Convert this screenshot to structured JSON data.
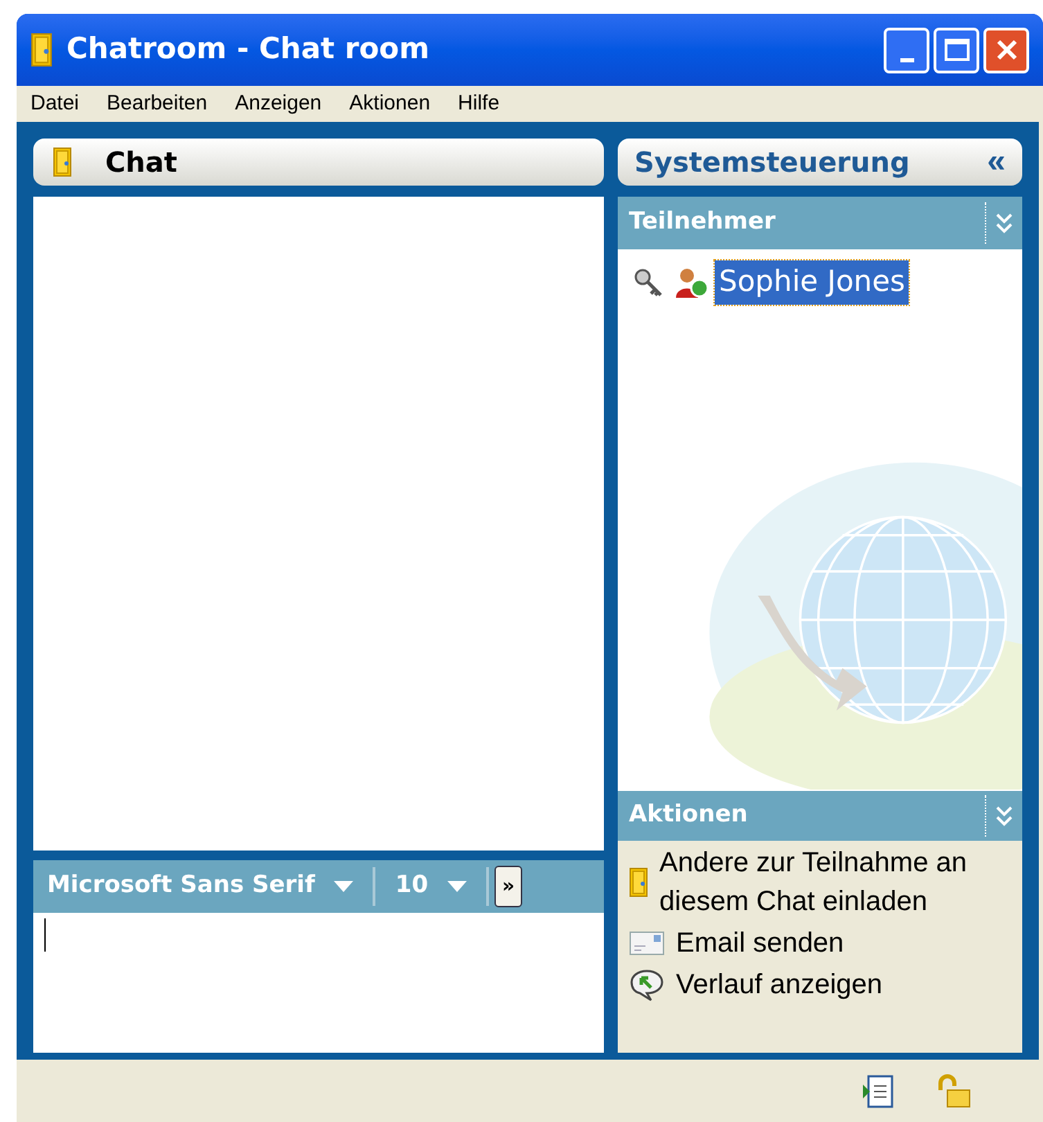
{
  "window": {
    "title": "Chatroom - Chat room"
  },
  "menu": [
    "Datei",
    "Bearbeiten",
    "Anzeigen",
    "Aktionen",
    "Hilfe"
  ],
  "chat_panel": {
    "title": "Chat",
    "font": "Microsoft Sans Serif",
    "font_size": "10",
    "more": "»"
  },
  "side_panel": {
    "title": "Systemsteuerung",
    "collapse": "«",
    "participants": {
      "title": "Teilnehmer",
      "items": [
        {
          "name": "Sophie Jones",
          "selected": true
        }
      ]
    },
    "actions": {
      "title": "Aktionen",
      "items": [
        {
          "kind": "invite",
          "label": "Andere zur Teilnahme an diesem Chat einladen"
        },
        {
          "kind": "email",
          "label": "Email senden"
        },
        {
          "kind": "history",
          "label": "Verlauf anzeigen"
        }
      ]
    }
  }
}
